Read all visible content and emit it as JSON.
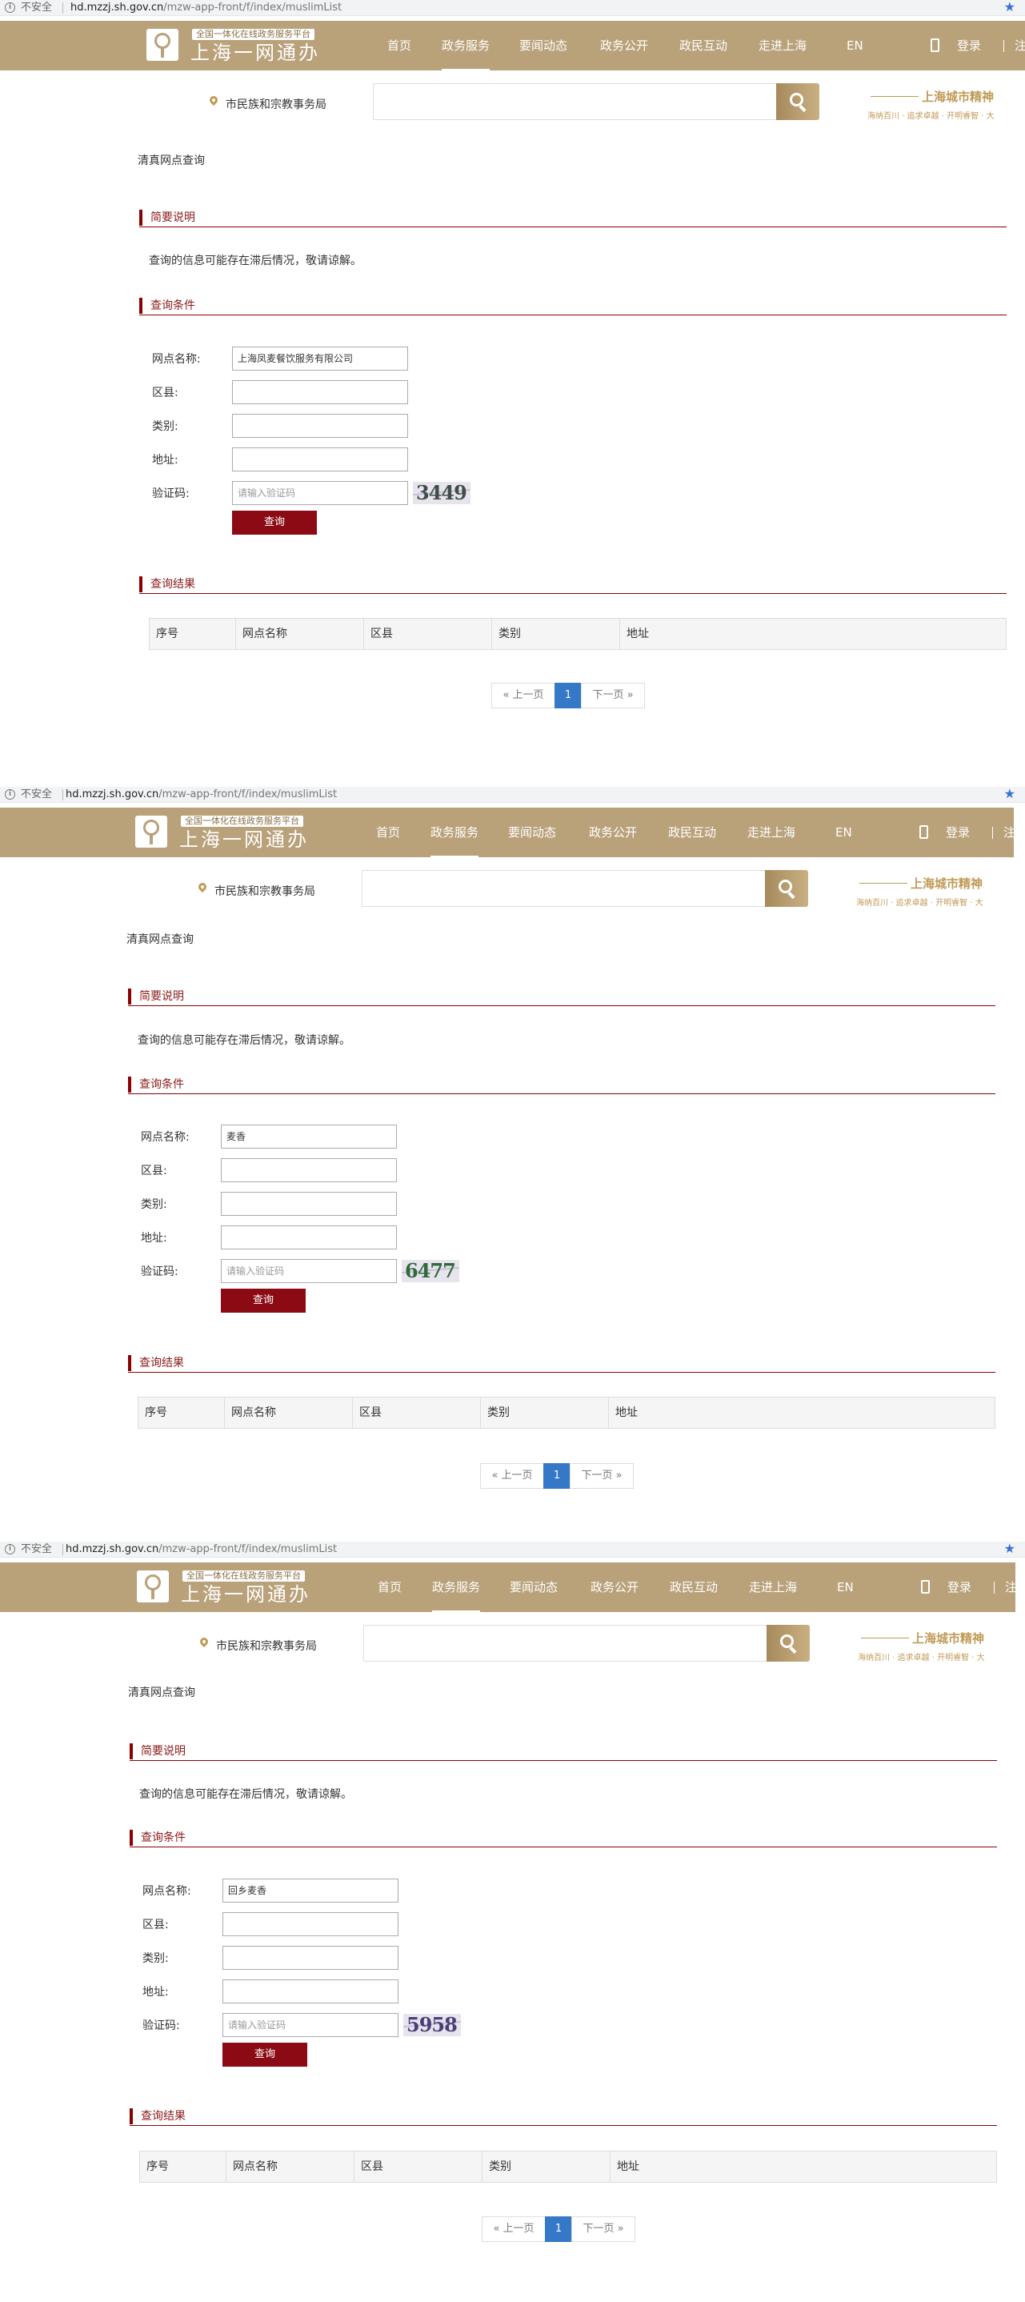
{
  "browser": {
    "info_icon": "info-icon",
    "insecure_label": "不安全",
    "url_host": "hd.mzzj.sh.gov.cn",
    "url_path": "/mzw-app-front/f/index/muslimList",
    "bookmark_icon": "star-icon"
  },
  "header": {
    "slogan": "全国一体化在线政务服务平台",
    "brand": "上海一网通办",
    "nav": [
      "首页",
      "政务服务",
      "要闻动态",
      "政务公开",
      "政民互动",
      "走进上海",
      "EN"
    ],
    "active_nav": "政务服务",
    "login": "登录",
    "register_stub": "注",
    "colors": {
      "header_bg": "#b9a17a",
      "accent_red": "#8b0a14",
      "page_blue": "#3578c8"
    }
  },
  "search_band": {
    "bureau": "市民族和宗教事务局",
    "spirit_title": "上海城市精神",
    "spirit_sub": "海纳百川 · 追求卓越 · 开明睿智 · 大"
  },
  "content": {
    "page_title": "清真网点查询",
    "section_notes": "简要说明",
    "note_text": "查询的信息可能存在滞后情况，敬请谅解。",
    "section_conditions": "查询条件",
    "label_name": "网点名称:",
    "label_district": "区县:",
    "label_category": "类别:",
    "label_address": "地址:",
    "label_captcha": "验证码:",
    "captcha_placeholder": "请输入验证码",
    "query_button": "查询",
    "section_results": "查询结果",
    "table_headers": [
      "序号",
      "网点名称",
      "区县",
      "类别",
      "地址"
    ],
    "pager": {
      "prev": "« 上一页",
      "current": "1",
      "next": "下一页 »"
    }
  },
  "screenshots": [
    {
      "name_value": "上海凤麦餐饮服务有限公司",
      "captcha_text": "3449"
    },
    {
      "name_value": "麦香",
      "captcha_text": "6477"
    },
    {
      "name_value": "回乡麦香",
      "captcha_text": "5958"
    }
  ]
}
